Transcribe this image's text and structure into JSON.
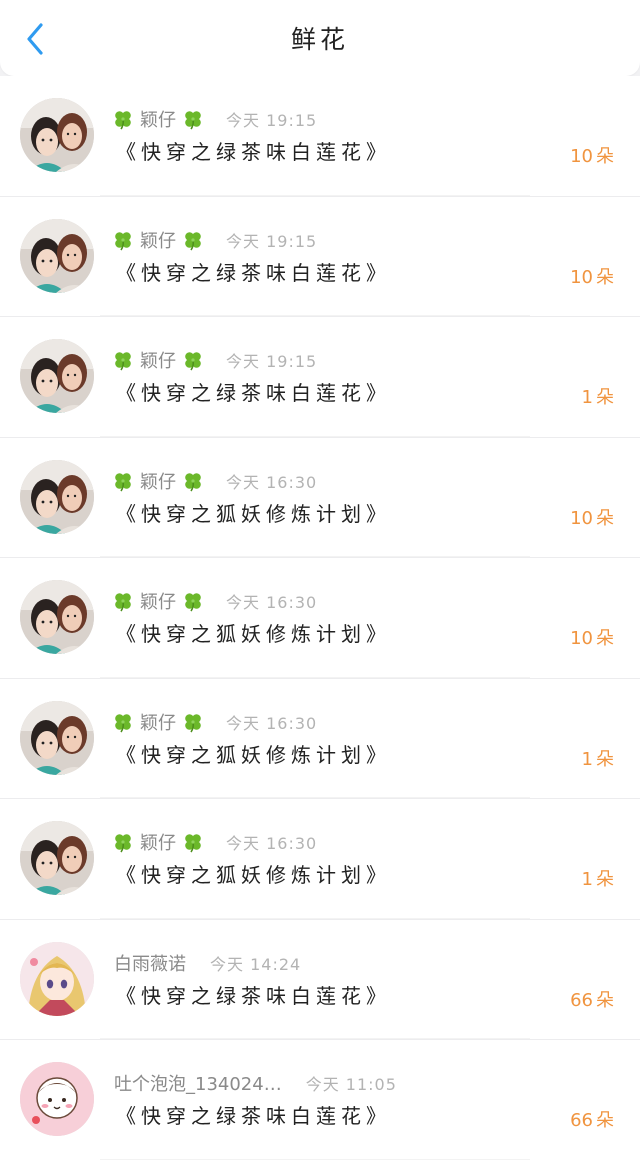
{
  "header": {
    "title": "鲜花",
    "back_icon": "chevron-left-icon",
    "accent": "#2f9bf0"
  },
  "colors": {
    "count": "#f0943f",
    "clover": "#6bb82a"
  },
  "rows": [
    {
      "name": "颖仔",
      "clover": true,
      "time": "今天 19:15",
      "book": "《快穿之绿茶味白莲花》",
      "count": "10",
      "unit": "朵",
      "avatar": "photo"
    },
    {
      "name": "颖仔",
      "clover": true,
      "time": "今天 19:15",
      "book": "《快穿之绿茶味白莲花》",
      "count": "10",
      "unit": "朵",
      "avatar": "photo"
    },
    {
      "name": "颖仔",
      "clover": true,
      "time": "今天 19:15",
      "book": "《快穿之绿茶味白莲花》",
      "count": "1",
      "unit": "朵",
      "avatar": "photo"
    },
    {
      "name": "颖仔",
      "clover": true,
      "time": "今天 16:30",
      "book": "《快穿之狐妖修炼计划》",
      "count": "10",
      "unit": "朵",
      "avatar": "photo"
    },
    {
      "name": "颖仔",
      "clover": true,
      "time": "今天 16:30",
      "book": "《快穿之狐妖修炼计划》",
      "count": "10",
      "unit": "朵",
      "avatar": "photo"
    },
    {
      "name": "颖仔",
      "clover": true,
      "time": "今天 16:30",
      "book": "《快穿之狐妖修炼计划》",
      "count": "1",
      "unit": "朵",
      "avatar": "photo"
    },
    {
      "name": "颖仔",
      "clover": true,
      "time": "今天 16:30",
      "book": "《快穿之狐妖修炼计划》",
      "count": "1",
      "unit": "朵",
      "avatar": "photo"
    },
    {
      "name": "白雨薇诺",
      "clover": false,
      "time": "今天 14:24",
      "book": "《快穿之绿茶味白莲花》",
      "count": "66",
      "unit": "朵",
      "avatar": "anime"
    },
    {
      "name": "吐个泡泡_134024…",
      "clover": false,
      "time": "今天 11:05",
      "book": "《快穿之绿茶味白莲花》",
      "count": "66",
      "unit": "朵",
      "avatar": "cartoon"
    }
  ]
}
